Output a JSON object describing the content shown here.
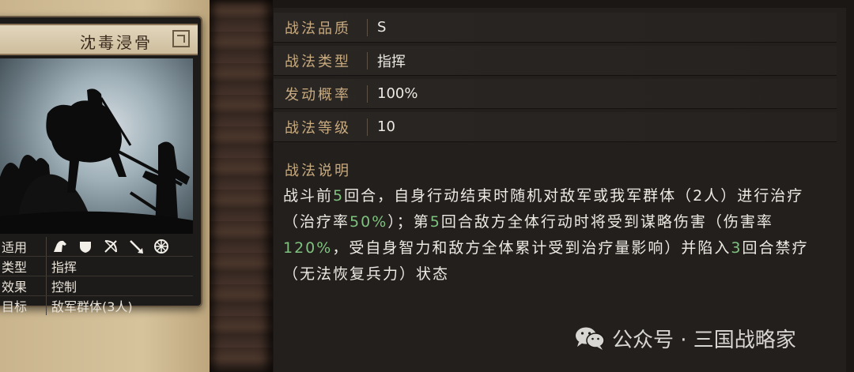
{
  "card": {
    "title": "沈毒浸骨",
    "rows": [
      {
        "label": "适用",
        "value": "",
        "icons": [
          "horse-icon",
          "shield-icon",
          "bow-icon",
          "spear-icon",
          "wheel-icon"
        ]
      },
      {
        "label": "类型",
        "value": "指挥"
      },
      {
        "label": "效果",
        "value": "控制"
      },
      {
        "label": "目标",
        "value": "敌军群体(3人)"
      }
    ]
  },
  "attributes": [
    {
      "label": "战法品质",
      "value": "S"
    },
    {
      "label": "战法类型",
      "value": "指挥"
    },
    {
      "label": "发动概率",
      "value": "100%"
    },
    {
      "label": "战法等级",
      "value": "10"
    }
  ],
  "description": {
    "title": "战法说明",
    "segments": [
      {
        "t": "战斗前",
        "hl": false
      },
      {
        "t": "5",
        "hl": true
      },
      {
        "t": "回合，自身行动结束时随机对敌军或我军群体（2人）进行治疗（治疗率",
        "hl": false
      },
      {
        "t": "50%",
        "hl": true
      },
      {
        "t": "）；第",
        "hl": false
      },
      {
        "t": "5",
        "hl": true
      },
      {
        "t": "回合敌方全体行动时将受到谋略伤害（伤害率",
        "hl": false
      },
      {
        "t": "120%",
        "hl": true
      },
      {
        "t": "，受自身智力和敌方全体累计受到治疗量影响）并陷入",
        "hl": false
      },
      {
        "t": "3",
        "hl": true
      },
      {
        "t": "回合禁疗（无法恢复兵力）状态",
        "hl": false
      }
    ]
  },
  "watermark": {
    "text": "公众号 · 三国战略家"
  },
  "colors": {
    "label_gold": "#c9ab80",
    "highlight_green": "#7fc27f",
    "text_light": "#ece8e2"
  }
}
